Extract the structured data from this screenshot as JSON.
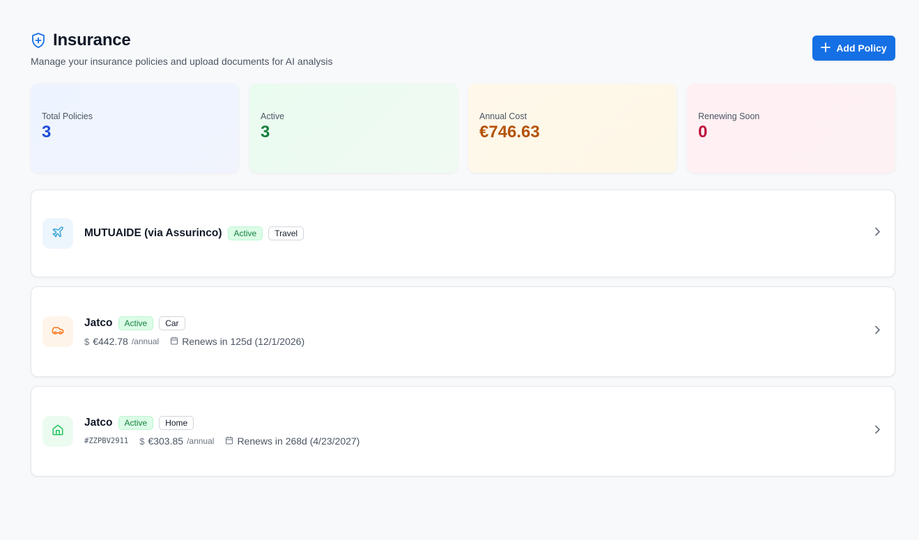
{
  "header": {
    "title": "Insurance",
    "subtitle": "Manage your insurance policies and upload documents for AI analysis",
    "add_button_label": "Add Policy",
    "icon": "shield-plus-icon"
  },
  "stats": [
    {
      "label": "Total Policies",
      "value": "3",
      "color": "#1d4ed8"
    },
    {
      "label": "Active",
      "value": "3",
      "color": "#15803d"
    },
    {
      "label": "Annual Cost",
      "value": "€746.63",
      "color": "#b45309"
    },
    {
      "label": "Renewing Soon",
      "value": "0",
      "color": "#be123c"
    }
  ],
  "policies": [
    {
      "name": "MUTUAIDE (via Assurinco)",
      "status": "Active",
      "type": "Travel",
      "icon": "plane-icon"
    },
    {
      "name": "Jatco",
      "status": "Active",
      "type": "Car",
      "icon": "car-icon",
      "currency_icon": "$",
      "premium": "€442.78",
      "period": "/annual",
      "renewal": "Renews in 125d (12/1/2026)"
    },
    {
      "name": "Jatco",
      "status": "Active",
      "type": "Home",
      "icon": "home-icon",
      "policy_number": "#ZZPBV2911",
      "currency_icon": "$",
      "premium": "€303.85",
      "period": "/annual",
      "renewal": "Renews in 268d (4/23/2027)"
    }
  ]
}
